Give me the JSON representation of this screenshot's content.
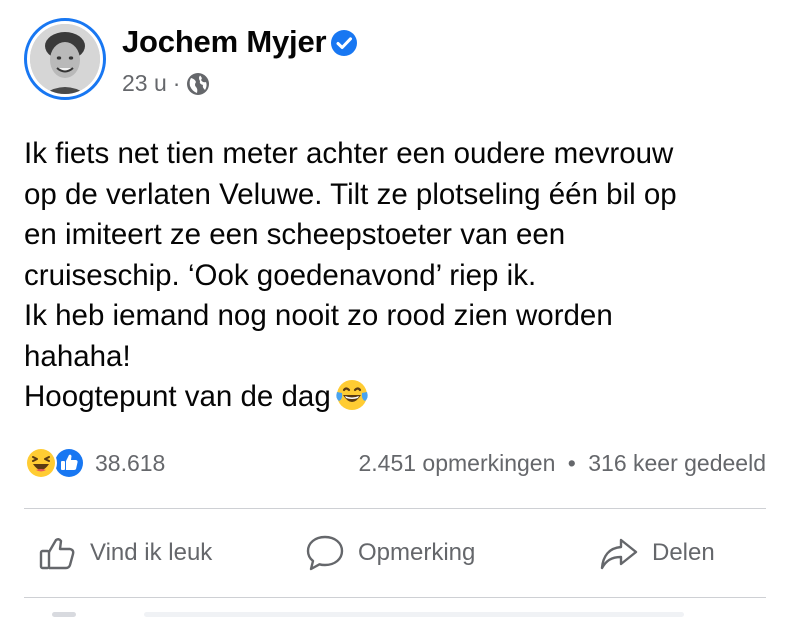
{
  "post": {
    "author": "Jochem Myjer",
    "verified": true,
    "time": "23 u",
    "separator": "·",
    "privacy_icon": "globe-icon",
    "lines": [
      "Ik fiets net tien meter achter een oudere mevrouw",
      "op de verlaten Veluwe. Tilt ze plotseling één bil op",
      "en imiteert ze een scheepstoeter van een",
      "cruiseschip. ‘Ook goedenavond’ riep ik.",
      "Ik heb iemand nog nooit zo rood zien worden",
      "hahaha!",
      "Hoogtepunt van de dag"
    ],
    "trailing_emoji": "tears-of-joy-emoji"
  },
  "reactions": {
    "icons": [
      "haha-reaction-icon",
      "like-reaction-icon"
    ],
    "count": "38.618"
  },
  "stats": {
    "comments": "2.451 opmerkingen",
    "separator": "•",
    "shares": "316 keer gedeeld"
  },
  "actions": {
    "like": "Vind ik leuk",
    "comment": "Opmerking",
    "share": "Delen"
  },
  "colors": {
    "accent": "#1877f2",
    "secondary_text": "#65676b",
    "primary_text": "#050505",
    "divider": "#ced0d4"
  }
}
